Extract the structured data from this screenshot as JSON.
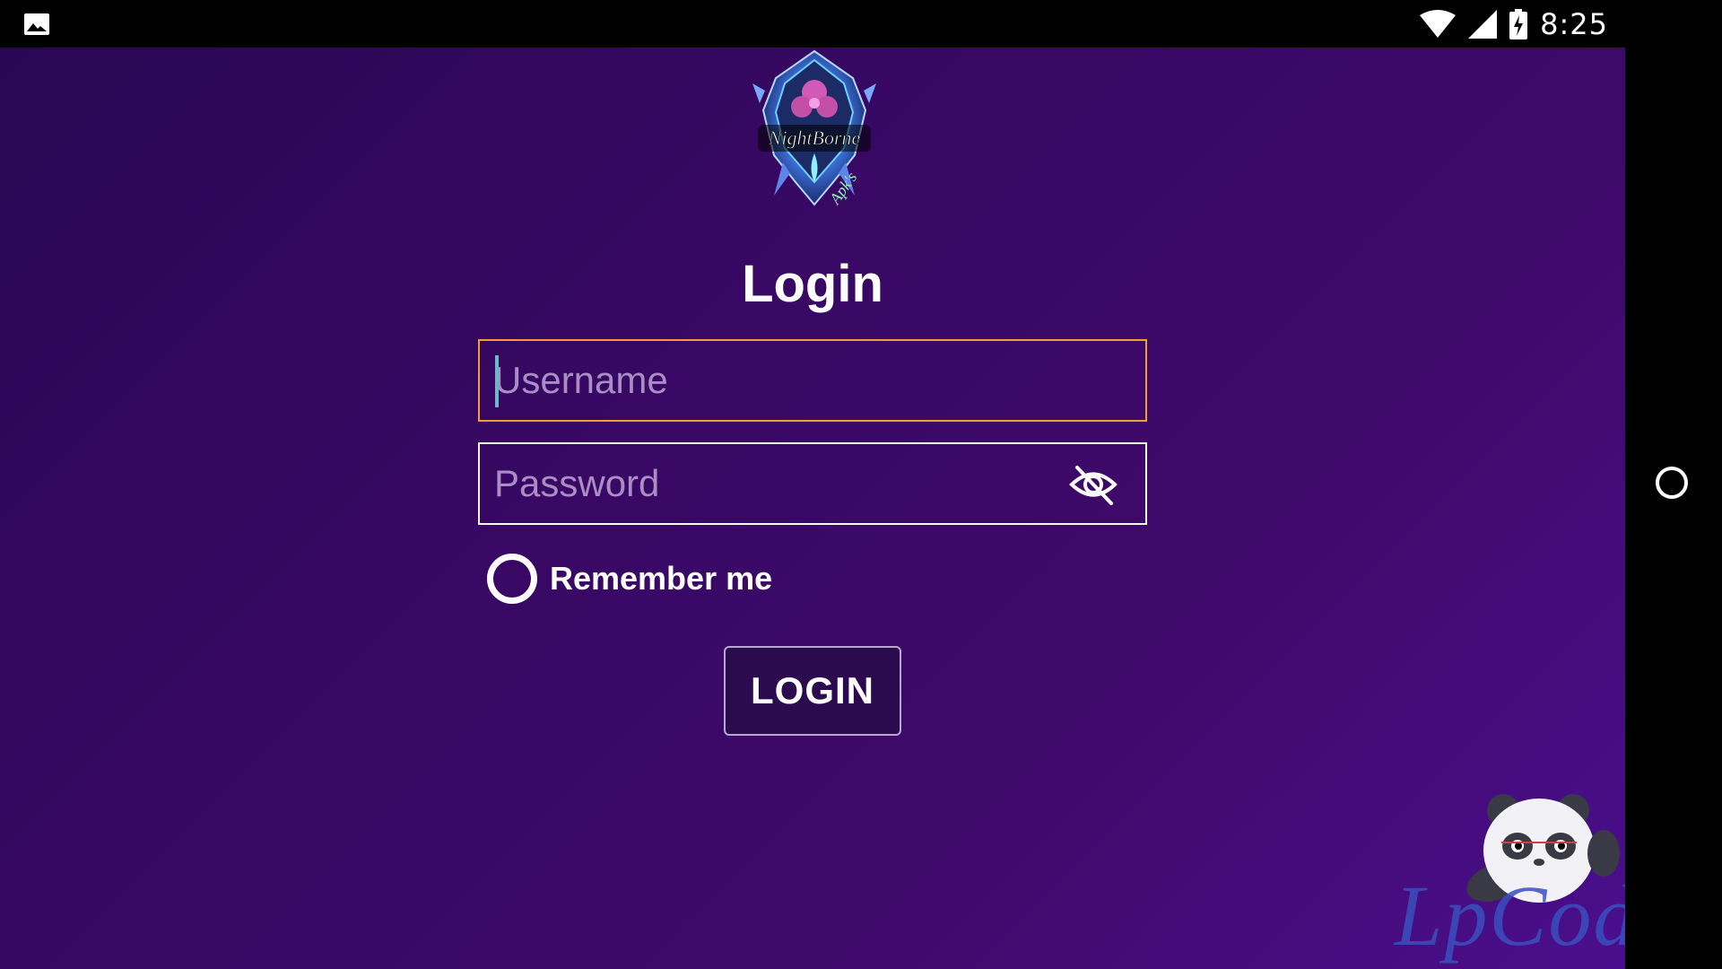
{
  "status_bar": {
    "time": "8:25",
    "icons": [
      "gallery-icon",
      "wifi-icon",
      "signal-icon",
      "battery-charging-icon"
    ]
  },
  "logo": {
    "text_main": "NightBorne",
    "text_sub": "Apk's"
  },
  "login_form": {
    "title": "Login",
    "username_placeholder": "Username",
    "password_placeholder": "Password",
    "password_toggle_icon": "eye-off-icon",
    "remember_label": "Remember me",
    "remember_checked": false,
    "login_button": "LOGIN"
  },
  "watermark": {
    "text": "LpCodes"
  },
  "colors": {
    "background_start": "#2a0754",
    "background_end": "#4a0e8c",
    "focus_border": "#f0a030",
    "placeholder": "#a98dc4",
    "watermark": "#3a4fbf"
  }
}
